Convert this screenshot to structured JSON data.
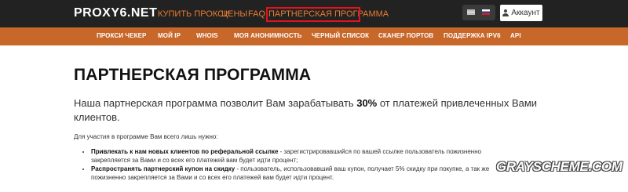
{
  "header": {
    "logo_prefix": "PROXY",
    "logo_number": "6",
    "logo_suffix": ".NET",
    "nav": [
      "КУПИТЬ ПРОКСИ",
      "ЦЕНЫ",
      "FAQ",
      "ПАРТНЕРСКАЯ ПРОГРАММА"
    ],
    "account_label": "Аккаунт",
    "languages": [
      "en",
      "ru"
    ]
  },
  "menu": {
    "items": [
      "ПРОКСИ ЧЕКЕР",
      "МОЙ IP",
      "WHOIS",
      "МОЯ АНОНИМНОСТЬ",
      "ЧЕРНЫЙ СПИСОК",
      "СКАНЕР ПОРТОВ",
      "ПОДДЕРЖКА IPV6",
      "API"
    ]
  },
  "main": {
    "title": "ПАРТНЕРСКАЯ ПРОГРАММА",
    "lead_before": "Наша партнерская программа позволит Вам зарабатывать ",
    "lead_bold": "30%",
    "lead_after": " от платежей привлеченных Вами клиентов.",
    "intro": "Для участия в программе Вам всего лишь нужно:",
    "items": [
      {
        "bold": "Привлекать к нам новых клиентов по реферальной ссылке",
        "text": " - зарегистрировавшийся по вашей ссылке пользователь пожизненно закрепляется за Вами и со всех его платежей вам будет идти процент;"
      },
      {
        "bold": "Распространять партнерский купон на скидку",
        "text": " - пользователь, использовавший ваш купон, получает 5% скидку при покупке, а так же пожизненно закрепляется за Вами и со всех его платежей вам будет идти процент."
      }
    ]
  },
  "watermark": "GRAYSCHEME.COM",
  "colors": {
    "topbar": "#222222",
    "accent_orange": "#c8672a",
    "nav_link": "#e87b33",
    "highlight_box": "#e1141e"
  }
}
